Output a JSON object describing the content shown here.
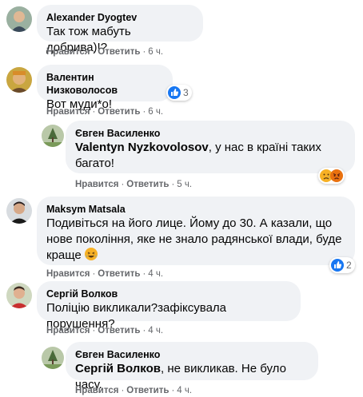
{
  "comments": [
    {
      "author": "Alexander Dyogtev",
      "text": "Так тож мабуть добрива)!?",
      "like": "Нравится",
      "reply": "Ответить",
      "time": "6 ч."
    },
    {
      "author": "Валентин Низковолосов",
      "text": "Вот муди*о!",
      "like": "Нравится",
      "reply": "Ответить",
      "time": "6 ч.",
      "reaction_count": "3"
    },
    {
      "author": "Євген Василенко",
      "mention": "Valentyn Nyzkovolosov",
      "text": ", у нас в країні таких багато!",
      "like": "Нравится",
      "reply": "Ответить",
      "time": "5 ч."
    },
    {
      "author": "Maksym Matsala",
      "text": "Подивіться на його лице. Йому до 30. А казали, що нове покоління, яке не знало радянської влади, буде краще",
      "like": "Нравится",
      "reply": "Ответить",
      "time": "4 ч.",
      "reaction_count": "2"
    },
    {
      "author": "Сергій Волков",
      "text": "Поліцію викликали?зафіксувала порушення?",
      "like": "Нравится",
      "reply": "Ответить",
      "time": "4 ч."
    },
    {
      "author": "Євген Василенко",
      "mention": "Сергій Волков",
      "text": ", не викликав. Не було часу.",
      "like": "Нравится",
      "reply": "Ответить",
      "time": "4 ч."
    }
  ],
  "colors": {
    "bubble": "#f0f2f5",
    "meta": "#65676b",
    "like_blue": "#1877f2",
    "emoji_yellow": "#f7b125",
    "angry_orange": "#e9710f"
  },
  "icons": {
    "like": "thumbs-up-icon",
    "haha": "laughing-emoji-icon",
    "sad": "sad-emoji-icon",
    "angry": "angry-emoji-icon"
  }
}
